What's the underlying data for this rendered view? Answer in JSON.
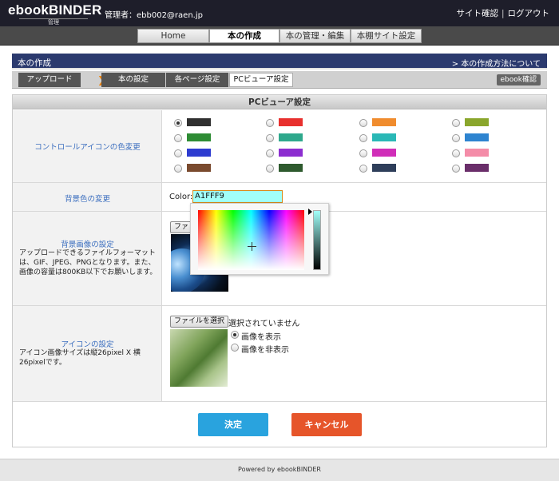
{
  "header": {
    "logo_main": "ebookBINDER",
    "logo_sub": "管理",
    "admin": "管理者：ebb002@raen.jp",
    "links": [
      "サイト確認",
      "ログアウト"
    ],
    "separator": "|"
  },
  "nav": {
    "tabs": [
      "Home",
      "本の作成",
      "本の管理・編集",
      "本棚サイト設定"
    ],
    "active_index": 1
  },
  "section": {
    "title": "本の作成",
    "help_link": "> 本の作成方法について"
  },
  "steps": {
    "items": [
      "アップロード",
      "本の設定",
      "各ページ設定",
      "PCビューア設定"
    ],
    "arrow": "❯",
    "current_index": 3,
    "ebook_check": "ebook確認"
  },
  "panel": {
    "title": "PCビューア設定",
    "icon_color": {
      "label": "コントロールアイコンの色変更",
      "selected_index": 0,
      "colors": [
        "#303030",
        "#e8302e",
        "#f08c2e",
        "#8aa62c",
        "#2e8c34",
        "#2ea88c",
        "#2ab8b6",
        "#2e84d0",
        "#2e3cd0",
        "#8c2ed0",
        "#d02eb8",
        "#f48ca8",
        "#7a4a2e",
        "#2e5a2e",
        "#2e3e5a",
        "#6a2e6a"
      ]
    },
    "bg_color": {
      "label": "背景色の変更",
      "color_label": "Color:",
      "value": "A1FFF9",
      "current_color": "#a1fff9"
    },
    "bg_image": {
      "title": "背景画像の設定",
      "desc": "アップロードできるファイルフォーマットは、GIF、JPEG、PNGとなります。また、画像の容量は800KB以下でお願いします。",
      "file_button": "ファイ"
    },
    "icon_setting": {
      "title": "アイコンの設定",
      "desc": "アイコン画像サイズは縦26pixel X 横26pixelです。",
      "file_button": "ファイルを選択",
      "file_status": "選択されていません",
      "options": [
        "画像を表示",
        "画像を非表示"
      ],
      "selected_index": 0
    },
    "buttons": {
      "ok": "決定",
      "cancel": "キャンセル"
    }
  },
  "footer": {
    "text": "Powered by ebookBINDER"
  }
}
